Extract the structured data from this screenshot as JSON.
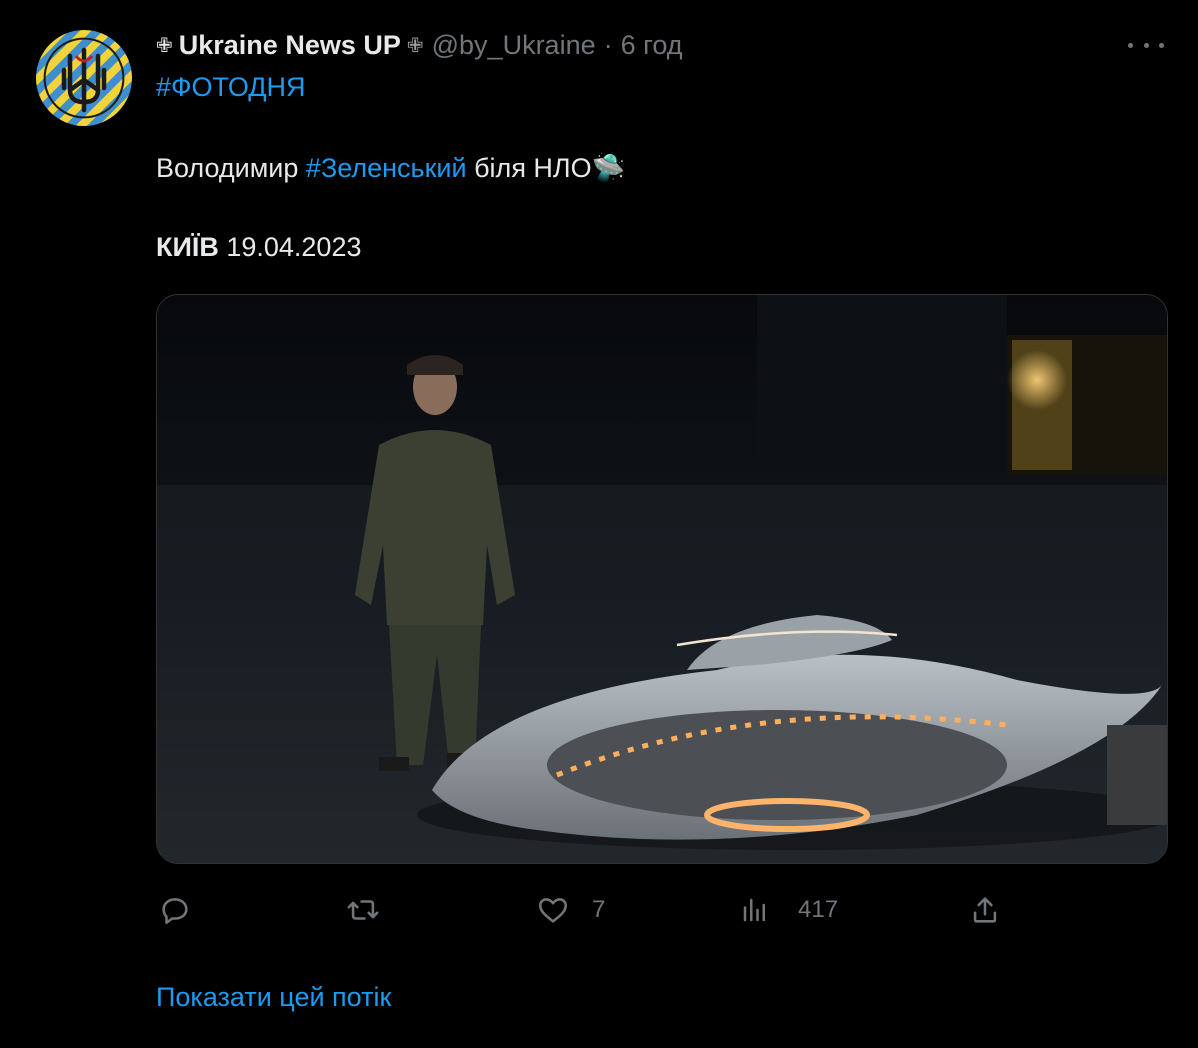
{
  "tweet": {
    "author_name": "Ukraine News UP",
    "name_prefix": "✙",
    "name_suffix": "✙",
    "handle": "@by_Ukraine",
    "separator": "·",
    "time": "6 год",
    "hashtag_line": "#ФОТОДНЯ",
    "body": {
      "part1": "Володимир ",
      "hashtag": "#Зеленський",
      "part2": " біля НЛО",
      "emoji": "🛸"
    },
    "place_bold": "КИЇВ",
    "date": " 19.04.2023"
  },
  "actions": {
    "reply": {
      "icon": "reply-icon",
      "count": ""
    },
    "retweet": {
      "icon": "retweet-icon",
      "count": ""
    },
    "like": {
      "icon": "heart-icon",
      "count": "7"
    },
    "views": {
      "icon": "views-icon",
      "count": "417"
    },
    "share": {
      "icon": "share-icon"
    }
  },
  "show_thread": "Показати цей потік",
  "colors": {
    "background": "#000000",
    "text": "#e7e9ea",
    "secondary": "#71767b",
    "link": "#1d9bf0"
  }
}
